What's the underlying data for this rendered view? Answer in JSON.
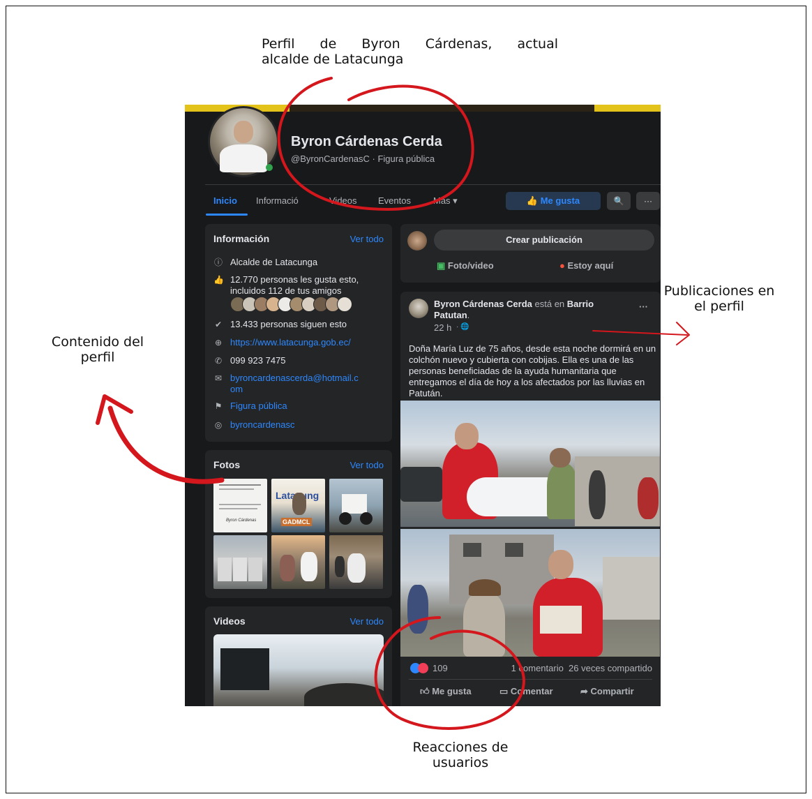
{
  "annotations": {
    "top_line1": "Perfil de Byron Cárdenas, actual",
    "top_line2": "alcalde de Latacunga",
    "left_line1": "Contenido del",
    "left_line2": "perfil",
    "right_line1": "Publicaciones en",
    "right_line2": "el perfil",
    "bottom_line1": "Reacciones de",
    "bottom_line2": "usuarios"
  },
  "profile": {
    "name": "Byron Cárdenas Cerda",
    "subtitle": "@ByronCardenasC · Figura pública"
  },
  "nav": {
    "tabs": [
      "Inicio",
      "Informació",
      "Videos",
      "Eventos",
      "Más ▾"
    ],
    "like_button": "👍 Me gusta",
    "search_icon": "🔍",
    "more_icon": "···"
  },
  "info": {
    "title": "Información",
    "see_all": "Ver todo",
    "role": "Alcalde de Latacunga",
    "likes_line1": "12.770 personas les gusta esto,",
    "likes_line2": "incluidos 112 de tus amigos",
    "followers": "13.433 personas siguen esto",
    "website": "https://www.latacunga.gob.ec/",
    "phone": "099 923 7475",
    "email_line1": "byroncardenascerda@hotmail.c",
    "email_line2": "om",
    "category": "Figura pública",
    "instagram": "byroncardenasc"
  },
  "photos": {
    "title": "Fotos",
    "see_all": "Ver todo",
    "thumb1_text": "Byron Cárdenas",
    "thumb2_text": "Latacung",
    "thumb2_sign": "GADMCL"
  },
  "videos": {
    "title": "Videos",
    "see_all": "Ver todo"
  },
  "composer": {
    "button": "Crear publicación",
    "photo_video": "Foto/video",
    "checkin": "Estoy aquí"
  },
  "post": {
    "author": "Byron Cárdenas Cerda",
    "is_at": "está en",
    "place_line1": "Barrio",
    "place_line2": "Patutan",
    "place_period": ".",
    "time": "22 h",
    "globe": "· 🌐",
    "more": "···",
    "text": "Doña María Luz de 75 años, desde esta noche dormirá en un colchón nuevo y cubierta con cobijas. Ella es una de las personas beneficiadas de la ayuda humanitaria que entregamos el día de hoy a los afectados por las lluvias en Patután.",
    "reaction_count": "109",
    "comments_shares": "1 comentario  26 veces compartido",
    "like": "Me gusta",
    "comment": "Comentar",
    "share": "Compartir"
  },
  "colors": {
    "fb_bg": "#18191a",
    "card_bg": "#242526",
    "accent_blue": "#2d88ff",
    "annotation_red": "#d4161d"
  }
}
